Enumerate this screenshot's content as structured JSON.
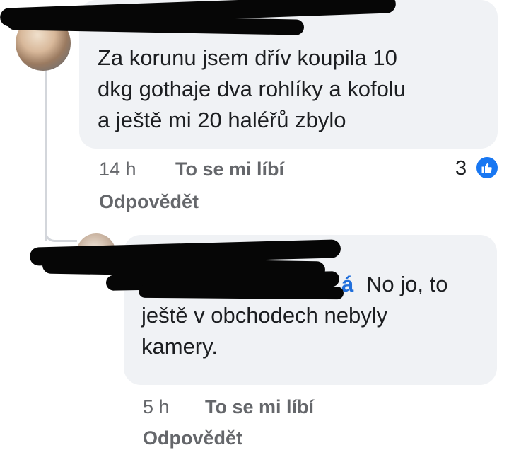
{
  "comment1": {
    "text": "Za korunu jsem dřív koupila 10\ndkg gothaje dva rohlíky a kofolu\na ještě mi 20 haléřů zbylo",
    "time": "14 h",
    "like_label": "To se mi líbí",
    "reply_label": "Odpovědět",
    "reaction_count": "3"
  },
  "comment2": {
    "mention_visible": "á",
    "text_line1": "No jo, to",
    "text_rest": "ještě v obchodech nebyly\nkamery.",
    "time": "5 h",
    "like_label": "To se mi líbí",
    "reply_label": "Odpovědět"
  },
  "colors": {
    "bubble": "#f0f2f5",
    "meta": "#65676b",
    "mention": "#216fdb",
    "like_blue": "#1877f2"
  },
  "icons": {
    "reaction": "thumbs-up-icon"
  }
}
